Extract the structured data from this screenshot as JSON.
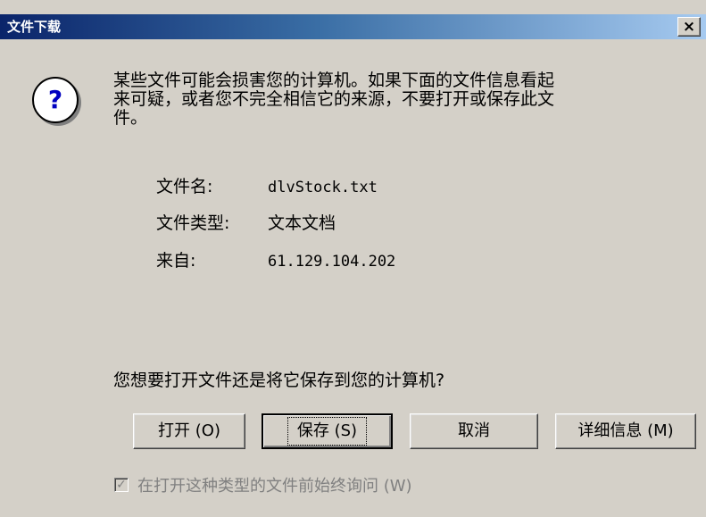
{
  "window": {
    "title": "文件下载",
    "close_symbol": "×"
  },
  "icon": {
    "name": "question-icon",
    "glyph": "?"
  },
  "message": {
    "lines": [
      "某些文件可能会损害您的计算机。如果下面的文件信息看起",
      "来可疑，或者您不完全相信它的来源，不要打开或保存此文",
      "件。"
    ]
  },
  "file_info": {
    "filename_label": "文件名:",
    "filename_value": "dlvStock.txt",
    "type_label": "文件类型:",
    "type_value": "文本文档",
    "from_label": "来自:",
    "from_value": "61.129.104.202"
  },
  "question": "您想要打开文件还是将它保存到您的计算机?",
  "buttons": {
    "open": "打开 (O)",
    "save": "保存 (S)",
    "cancel": "取消",
    "details": "详细信息 (M)"
  },
  "checkbox": {
    "label": "在打开这种类型的文件前始终询问 (W)",
    "checked": true,
    "enabled": false
  }
}
